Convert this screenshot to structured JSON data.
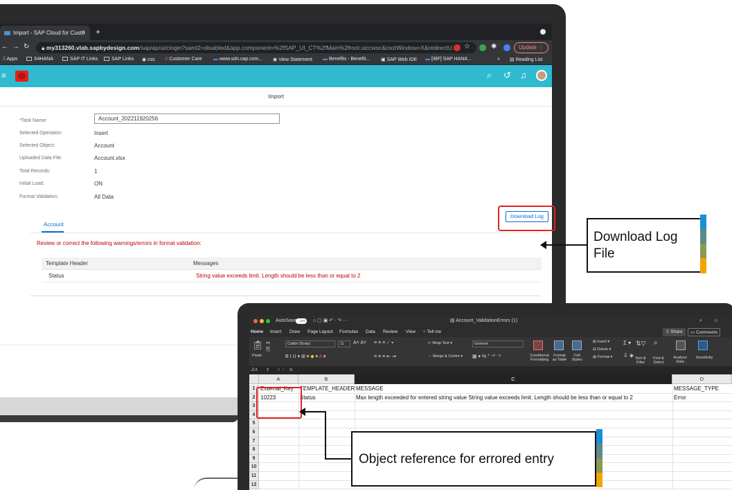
{
  "browser": {
    "tab_title": "Import - SAP Cloud for Custo",
    "tab_close": "×",
    "new_tab": "+",
    "url_domain": "my313260.vlab.sapbydesign.com",
    "url_path": "/sap/ap/ui/clogin?saml2=disabled&app.component=%2fSAP_UI_CT%2fMain%2froot.uiccwoc&rootWindow=X&redirectU...",
    "update_label": "Update",
    "bookmarks": [
      "Apps",
      "S4HANA",
      "SAP IT Links",
      "SAP Links",
      "css",
      "Customer Care",
      "www.sdn.sap.com...",
      "View Statement",
      "Benefits - Benefit...",
      "SAP Web IDE",
      "[IBF] SAP HANA...",
      "»",
      "Reading List"
    ]
  },
  "app": {
    "page_title": "Import",
    "form": {
      "task_name_label": "*Task Name:",
      "task_name_value": "Account_202211920256",
      "operation_label": "Selected Operation:",
      "operation_value": "Insert",
      "object_label": "Selected Object:",
      "object_value": "Account",
      "file_label": "Uploaded Data File:",
      "file_value": "Account.xlsx",
      "records_label": "Total Records:",
      "records_value": "1",
      "initial_load_label": "Initial Load:",
      "initial_load_value": "ON",
      "format_validation_label": "Format Validation:",
      "format_validation_value": "All Data"
    },
    "tab_account": "Account",
    "validation_message": "Review or correct the following warnings/errors in format validation:",
    "download_log_label": "Download Log",
    "table": {
      "headers": [
        "Template Header",
        "Messages"
      ],
      "rows": [
        {
          "header": "Status",
          "message": "String value exceeds limit. Length should be less than or equal to 2"
        }
      ]
    }
  },
  "callouts": {
    "download_log_file": [
      "Download Log",
      "File"
    ],
    "object_reference": "Object reference for errored entry"
  },
  "stripe_colors": [
    "#1a8fd6",
    "#5e8b8a",
    "#8a9a55",
    "#f0a500"
  ],
  "excel": {
    "autosave_label": "AutoSave",
    "toggle_label": "OFF",
    "file_title": "Account_ValidationErrors (1)",
    "share_label": "Share",
    "comments_label": "Comments",
    "tabs": [
      "Home",
      "Insert",
      "Draw",
      "Page Layout",
      "Formulas",
      "Data",
      "Review",
      "View",
      "Tell me"
    ],
    "ribbon": {
      "paste": "Paste",
      "font_name": "Calibri (Body)",
      "font_size": "11",
      "wrap_text": "Wrap Text",
      "merge_center": "Merge & Centre",
      "number_format": "General",
      "conditional": "Conditional Formatting",
      "format_table": "Format as Table",
      "cell_styles": "Cell Styles",
      "insert": "Insert",
      "delete": "Delete",
      "format": "Format",
      "sort_filter": "Sort & Filter",
      "find_select": "Find & Select",
      "analyse": "Analyse Data",
      "sensitivity": "Sensitivity"
    },
    "name_box": "J14",
    "fx": "fx",
    "columns": [
      "A",
      "B",
      "C",
      "D"
    ],
    "row_numbers": [
      "1",
      "2",
      "3",
      "4",
      "5",
      "6",
      "7",
      "8",
      "9",
      "10",
      "11",
      "12"
    ],
    "cells": {
      "A1": "External_Key",
      "B1": "TEMPLATE_HEADER",
      "C1": "MESSAGE",
      "D1": "MESSAGE_TYPE",
      "A2": "10223",
      "B2": "Status",
      "C2": "Max length exceeded for entered string value String value exceeds limit. Length should be less than or equal to 2",
      "D2": "Error"
    }
  }
}
